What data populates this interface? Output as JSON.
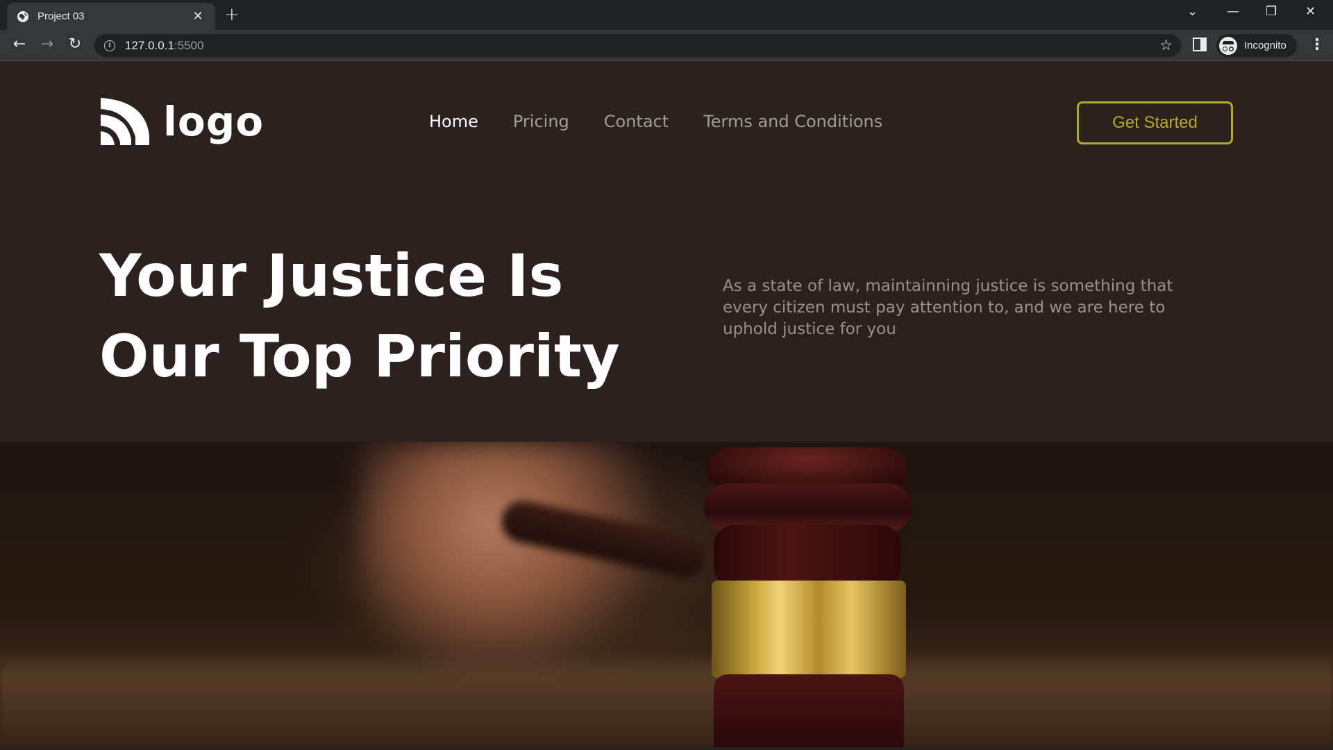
{
  "browser": {
    "tab_title": "Project 03",
    "tab_close": "✕",
    "new_tab": "+",
    "url_host": "127.0.0.1",
    "url_port": ":5500",
    "profile_label": "Incognito",
    "controls": {
      "back": "←",
      "forward": "→",
      "reload": "↻",
      "star": "☆",
      "menu": "⋮",
      "tab_list": "⌄",
      "minimize": "—",
      "restore": "❐",
      "close": "✕"
    }
  },
  "header": {
    "logo_text": "logo",
    "nav": [
      {
        "label": "Home",
        "active": true
      },
      {
        "label": "Pricing",
        "active": false
      },
      {
        "label": "Contact",
        "active": false
      },
      {
        "label": "Terms and Conditions",
        "active": false
      }
    ],
    "cta_label": "Get Started"
  },
  "hero": {
    "title_line1": "Your Justice Is",
    "title_line2": "Our Top Priority",
    "description": "As a state of law, maintainning justice is something that every citizen must pay attention to, and we are here to uphold justice for you"
  },
  "colors": {
    "background": "#2b211e",
    "accent": "#b5a92d",
    "nav_inactive": "#a39d98",
    "text_light": "#ffffff"
  }
}
